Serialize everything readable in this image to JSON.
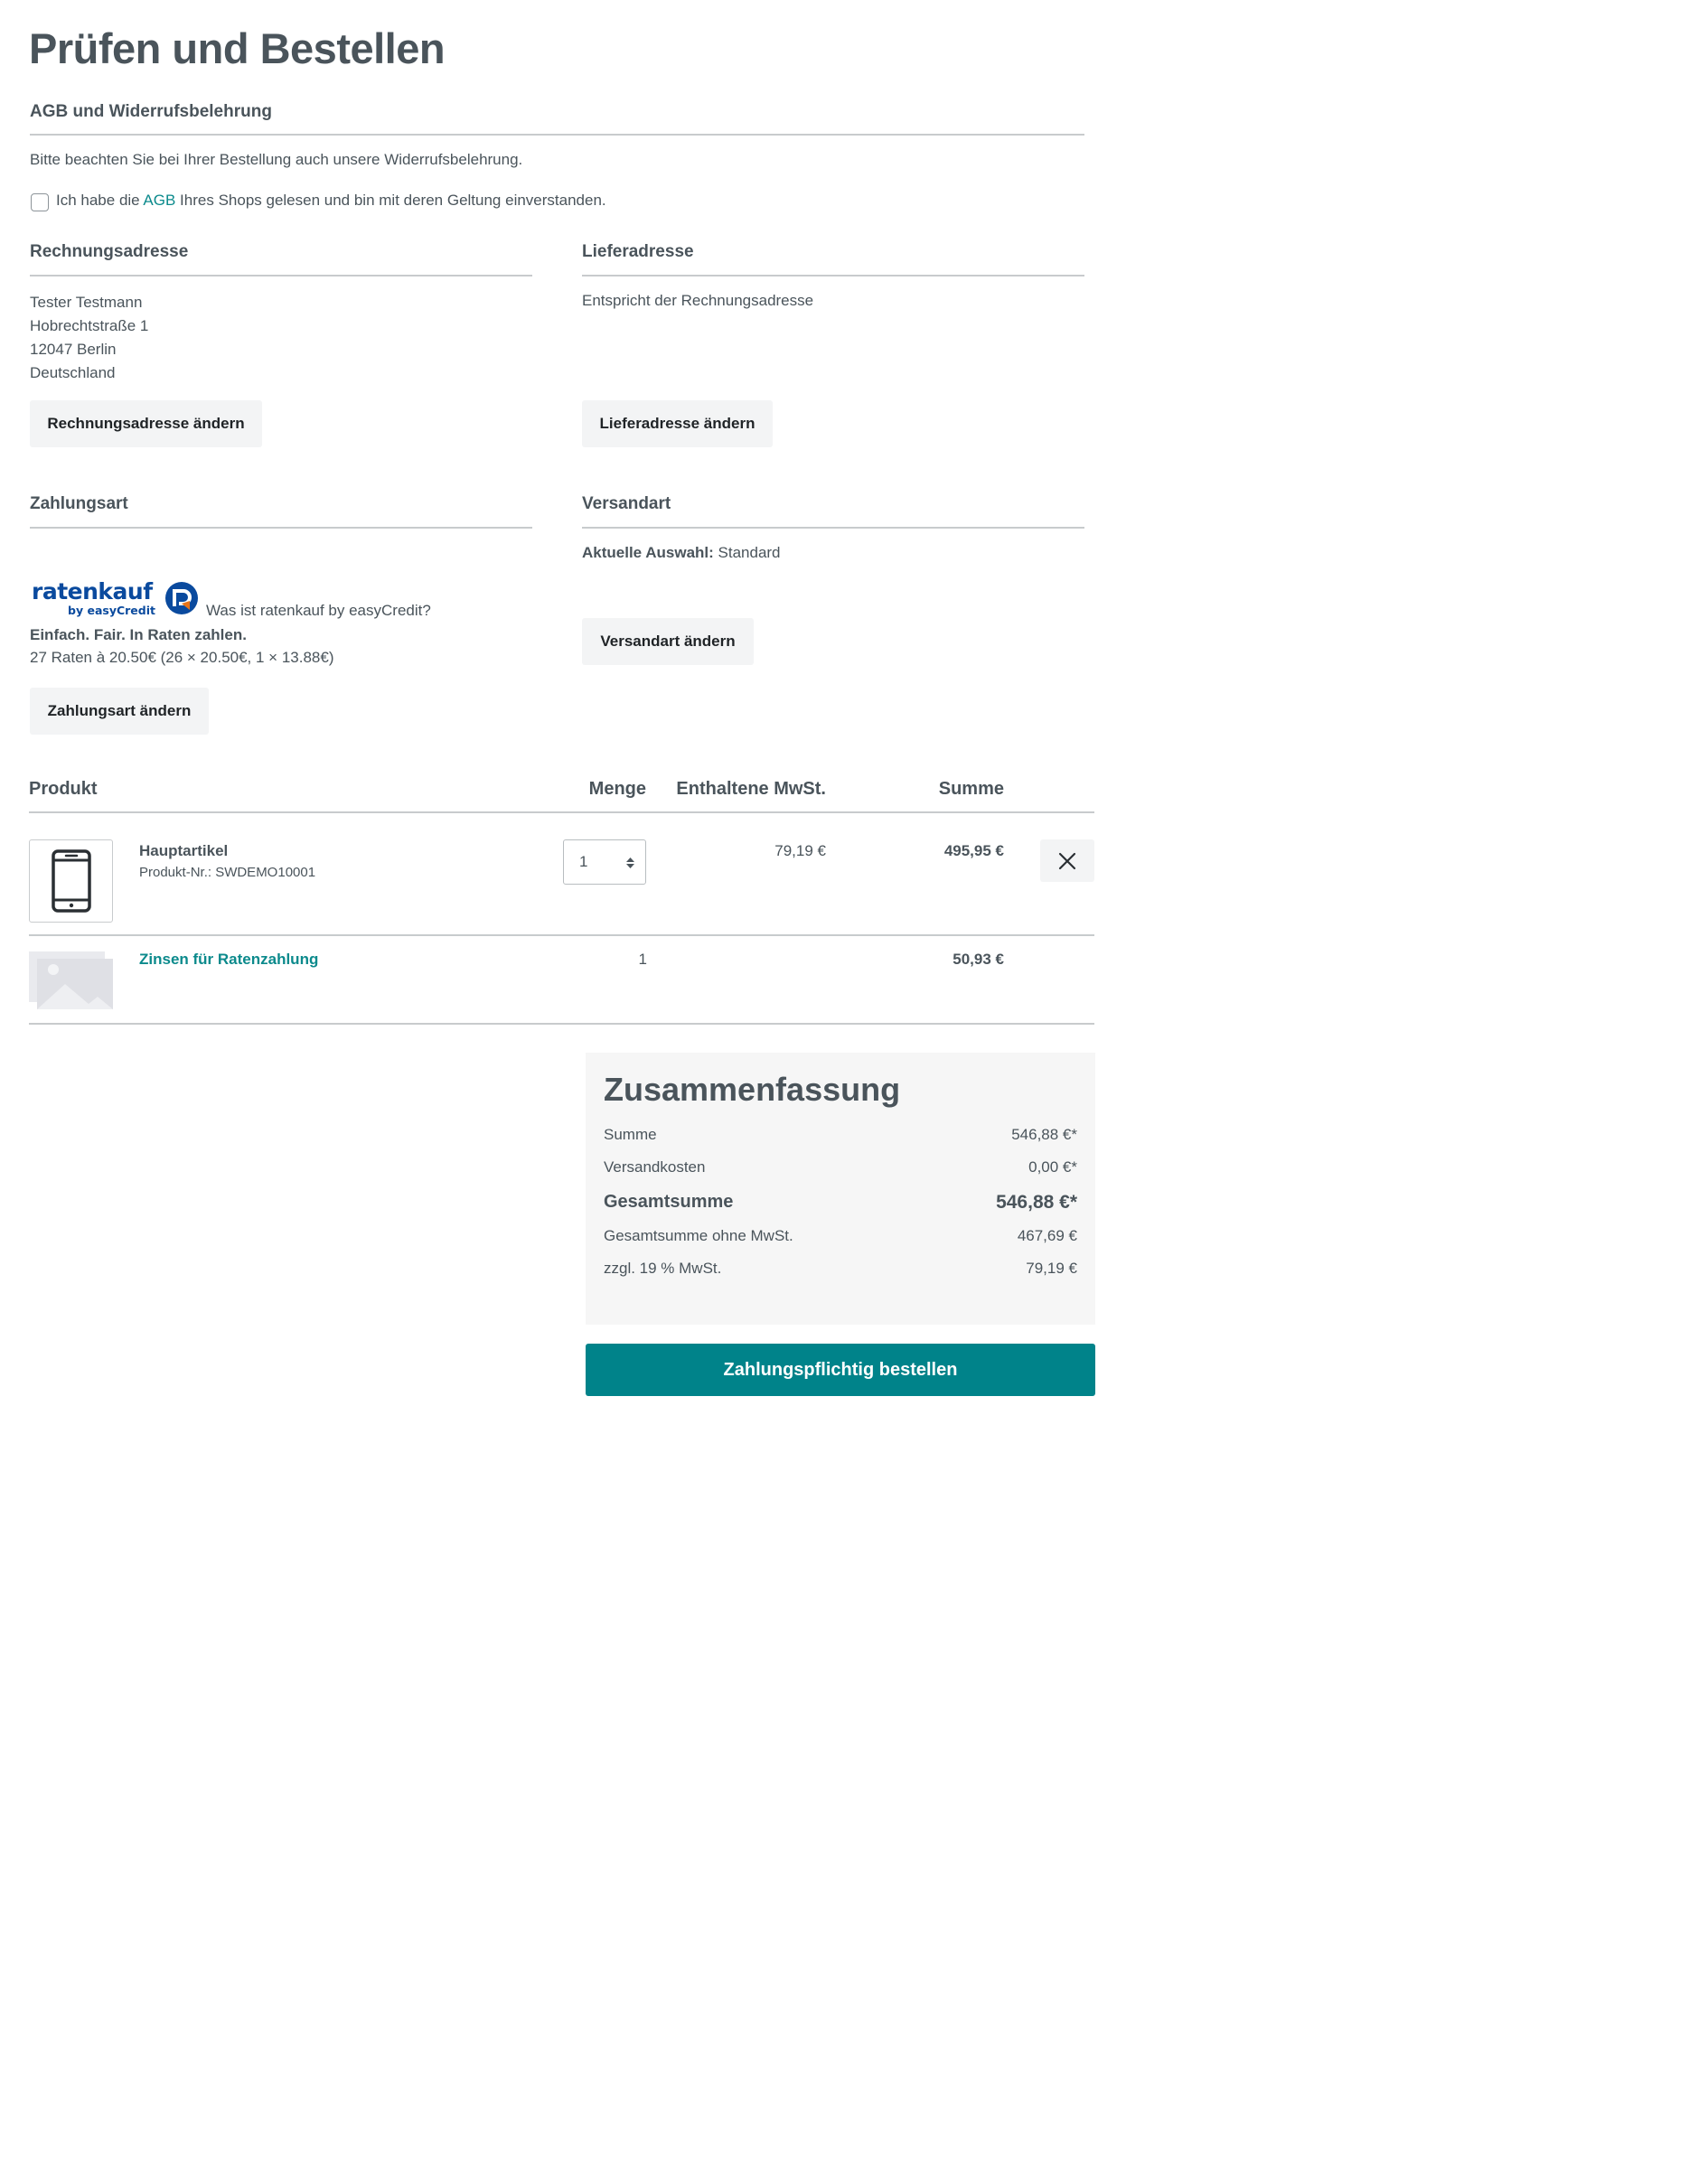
{
  "page": {
    "title": "Prüfen und Bestellen"
  },
  "terms": {
    "title": "AGB und Widerrufsbelehrung",
    "notice": "Bitte beachten Sie bei Ihrer Bestellung auch unsere Widerrufsbelehrung.",
    "checkbox_prefix": "Ich habe die ",
    "checkbox_link": "AGB",
    "checkbox_suffix": " Ihres Shops gelesen und bin mit deren Geltung einverstanden."
  },
  "billing": {
    "title": "Rechnungsadresse",
    "lines": [
      "Tester Testmann",
      "Hobrechtstraße 1",
      "12047 Berlin",
      "Deutschland"
    ],
    "button": "Rechnungsadresse ändern"
  },
  "shipping_address": {
    "title": "Lieferadresse",
    "text": "Entspricht der Rechnungsadresse",
    "button": "Lieferadresse ändern"
  },
  "payment": {
    "title": "Zahlungsart",
    "logo_word": "ratenkauf",
    "logo_sub": "by easyCredit",
    "info_link": "Was ist ratenkauf by easyCredit?",
    "tagline": "Einfach. Fair. In Raten zahlen.",
    "rates": "27 Raten à 20.50€ (26 × 20.50€, 1 × 13.88€)",
    "button": "Zahlungsart ändern",
    "colors": {
      "brand_blue": "#0a4a9e",
      "brand_orange": "#e8751a"
    }
  },
  "shipping_method": {
    "title": "Versandart",
    "current_label": "Aktuelle Auswahl:",
    "current_value": " Standard",
    "button": "Versandart ändern"
  },
  "cart": {
    "headers": {
      "product": "Produkt",
      "quantity": "Menge",
      "vat": "Enthaltene MwSt.",
      "total": "Summe"
    },
    "items": [
      {
        "name": "Hauptartikel",
        "sku": "Produkt-Nr.: SWDEMO10001",
        "quantity": "1",
        "vat": "79,19 €",
        "total": "495,95 €",
        "icon": "smartphone-icon"
      },
      {
        "name": "Zinsen für Ratenzahlung",
        "quantity": "1",
        "total": "50,93 €",
        "icon": "image-placeholder-icon"
      }
    ]
  },
  "summary": {
    "title": "Zusammenfassung",
    "rows": [
      {
        "label": "Summe",
        "value": "546,88 €*"
      },
      {
        "label": "Versandkosten",
        "value": "0,00 €*"
      },
      {
        "label": "Gesamtsumme",
        "value": "546,88 €*"
      },
      {
        "label": "Gesamtsumme ohne MwSt.",
        "value": "467,69 €"
      },
      {
        "label": "zzgl. 19 % MwSt.",
        "value": "79,19 €"
      }
    ]
  },
  "order_button": "Zahlungspflichtig bestellen",
  "colors": {
    "accent": "#00838a",
    "link": "#0b8a8c",
    "text": "#4a545b"
  }
}
